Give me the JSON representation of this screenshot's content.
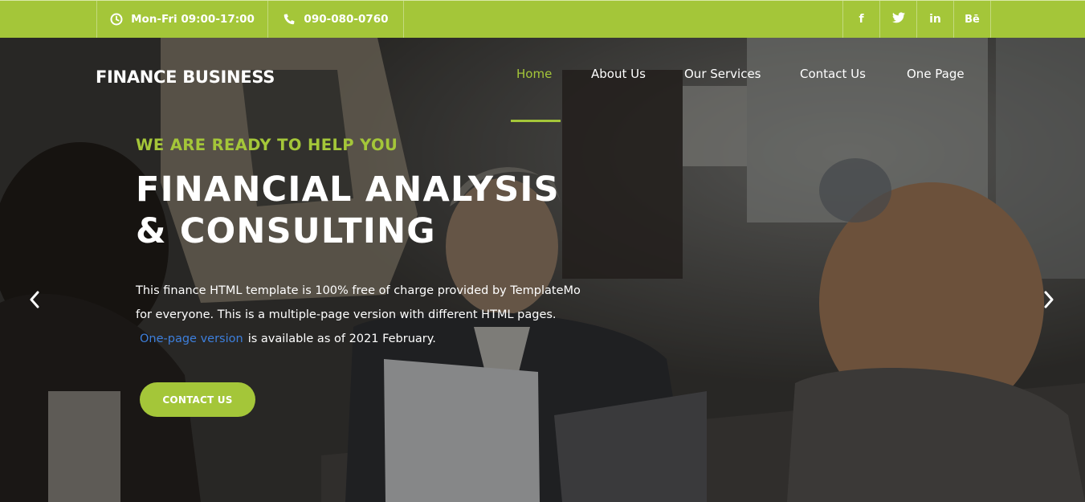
{
  "topbar": {
    "hours": "Mon-Fri 09:00-17:00",
    "phone": "090-080-0760",
    "hours_icon": "clock-icon",
    "phone_icon": "phone-icon",
    "social": [
      {
        "name": "facebook-icon",
        "glyph": "f"
      },
      {
        "name": "twitter-icon",
        "glyph": ""
      },
      {
        "name": "linkedin-icon",
        "glyph": "in"
      },
      {
        "name": "behance-icon",
        "glyph": "Bē"
      }
    ],
    "color": "#a4c639"
  },
  "header": {
    "logo": "FINANCE BUSINESS",
    "nav": [
      {
        "label": "Home",
        "active": true
      },
      {
        "label": "About Us",
        "active": false
      },
      {
        "label": "Our Services",
        "active": false
      },
      {
        "label": "Contact Us",
        "active": false
      },
      {
        "label": "One Page",
        "active": false
      }
    ]
  },
  "hero": {
    "eyebrow": "WE ARE READY TO HELP YOU",
    "headline_line1": "FINANCIAL ANALYSIS",
    "headline_line2": "& CONSULTING",
    "paragraph_line1": "This finance HTML template is 100% free of charge provided by TemplateMo",
    "paragraph_line2": "for everyone. This is a multiple-page version with different HTML pages.",
    "paragraph_link": "One-page version",
    "paragraph_line3_rest": "is available as of 2021 February.",
    "cta_label": "CONTACT US",
    "prev_icon": "chevron-left-icon",
    "next_icon": "chevron-right-icon"
  },
  "colors": {
    "accent": "#a4c639",
    "link": "#3d7fdc",
    "text": "#ffffff"
  }
}
